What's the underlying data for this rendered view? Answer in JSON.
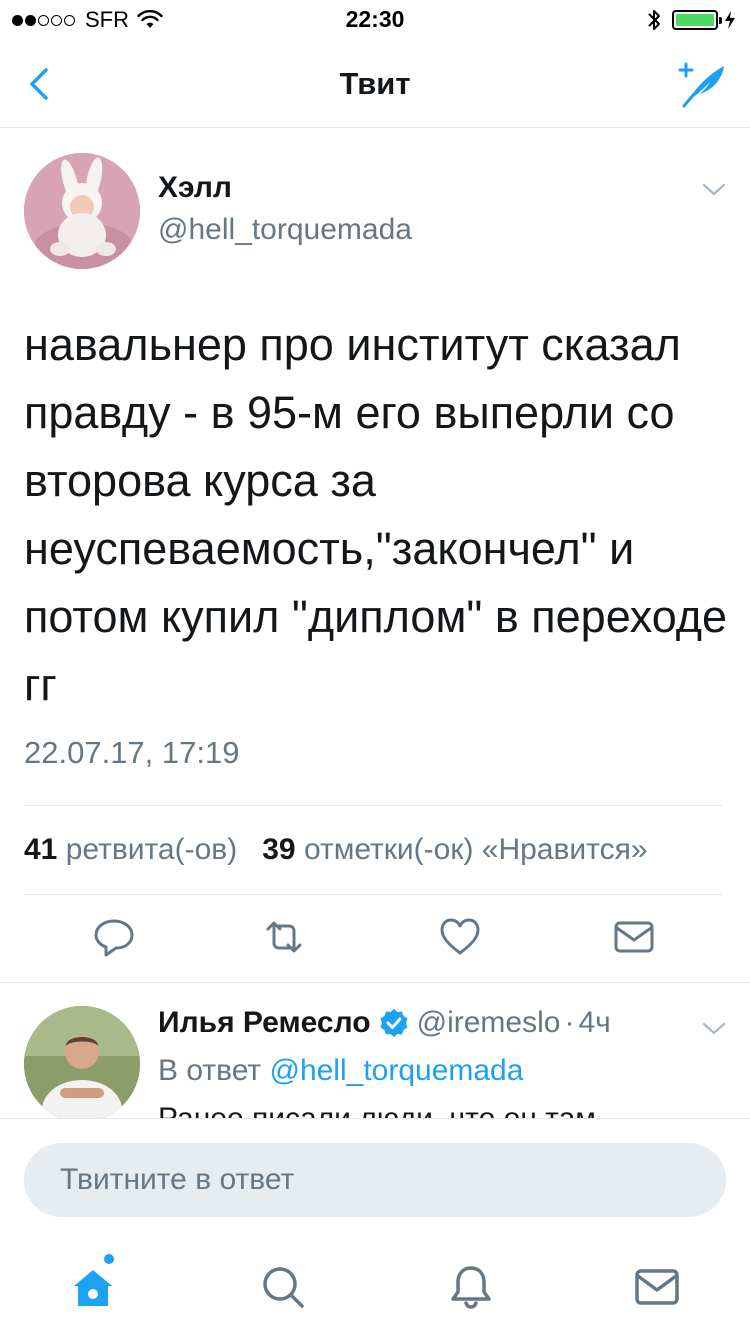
{
  "status_bar": {
    "carrier": "SFR",
    "time": "22:30",
    "signal_bars_filled": 2,
    "signal_bars_total": 5,
    "battery_level": 1.0,
    "icons": [
      "signal-icon",
      "wifi-icon",
      "bluetooth-icon",
      "battery-icon",
      "charging-icon"
    ]
  },
  "nav": {
    "title": "Твит",
    "back_icon": "chevron-left-icon",
    "compose_icon": "compose-tweet-icon"
  },
  "tweet": {
    "author_name": "Хэлл",
    "author_handle": "@hell_torquemada",
    "text": "навальнер про институт сказал правду - в 95-м его выперли со второва курса за неуспеваемость,\"закончел\" и потом купил \"диплом\" в переходе гг",
    "date": "22.07.17, 17:19",
    "retweets_count": "41",
    "retweets_label": "ретвита(-ов)",
    "likes_count": "39",
    "likes_label": "отметки(-ок) «Нравится»",
    "actions": [
      "reply-icon",
      "retweet-icon",
      "like-icon",
      "direct-message-icon"
    ]
  },
  "reply": {
    "author_name": "Илья Ремесло",
    "verified": true,
    "author_handle": "@iremeslo",
    "separator": "·",
    "time": "4ч",
    "reply_prefix": "В ответ",
    "reply_to": "@hell_torquemada",
    "text_preview": "Ранее писали люди, что он там"
  },
  "composer": {
    "placeholder": "Твитните в ответ"
  },
  "tabs": [
    "home-icon",
    "search-icon",
    "notifications-icon",
    "messages-icon"
  ],
  "colors": {
    "accent": "#1da1f2",
    "secondary_text": "#657786",
    "primary_text": "#14171a",
    "divider": "#e1e8ed",
    "battery": "#4cd964"
  }
}
